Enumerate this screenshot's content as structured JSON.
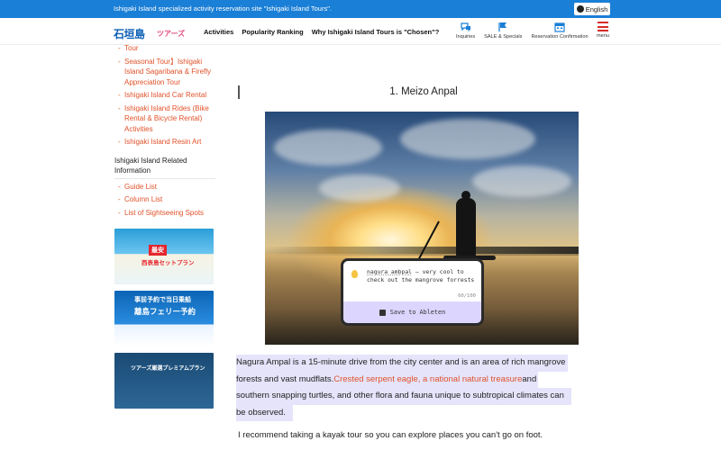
{
  "topbar": {
    "site_desc": "Ishigaki Island specialized activity reservation site \"Ishigaki Island Tours\".",
    "lang_label": "English"
  },
  "header": {
    "logo_main": "石垣島",
    "logo_sub": "ツアーズ",
    "nav": [
      "Activities",
      "Popularity Ranking",
      "Why Ishigaki Island Tours is \"Chosen\"?"
    ],
    "icons": [
      {
        "name": "inquiries-icon",
        "label": "Inquiries"
      },
      {
        "name": "sale-flag-icon",
        "label": "SALE & Specials"
      },
      {
        "name": "calendar-icon",
        "label": "Reservation Confirmation"
      }
    ],
    "menu_label": "menu"
  },
  "sidebar": {
    "top_items": [
      "Tour",
      "Seasonal Tour】Ishigaki Island Sagaribana & Firefly Appreciation Tour",
      "Ishigaki Island Car Rental",
      "Ishigaki Island Rides (Bike Rental & Bicycle Rental) Activities",
      "Ishigaki Island Resin Art"
    ],
    "related_title": "Ishigaki Island Related Information",
    "related_items": [
      "Guide List",
      "Column List",
      "List of Sightseeing Spots"
    ],
    "banner1": {
      "badge": "最安",
      "text": "西表島セットプラン"
    },
    "banner2": {
      "text": "事前予約で当日乗船",
      "text2": "離島フェリー予約"
    },
    "banner3": {
      "text": "ツアーズ厳選プレミアムプラン"
    }
  },
  "main": {
    "heading": "1. Meizo Anpal",
    "para1_lines": [
      {
        "text": "Nagura Ampal is a 15-minute drive from the city center and is an area of rich mangrove"
      },
      {
        "text_before": "forests and vast mudflats.",
        "red": "Crested serpent eagle, a national natural treasure",
        "text_after": "and"
      },
      {
        "text": "southern snapping turtles, and other flora and fauna unique to subtropical climates can"
      },
      {
        "text": "be observed."
      }
    ],
    "para2": "I recommend taking a kayak tour so you can explore places you can't go on foot."
  },
  "popup": {
    "note_word": "nagura ambpal",
    "note_rest": " – very cool to check out the mangrove forrests",
    "count": "60/100",
    "save_label": "Save to Ableten"
  }
}
